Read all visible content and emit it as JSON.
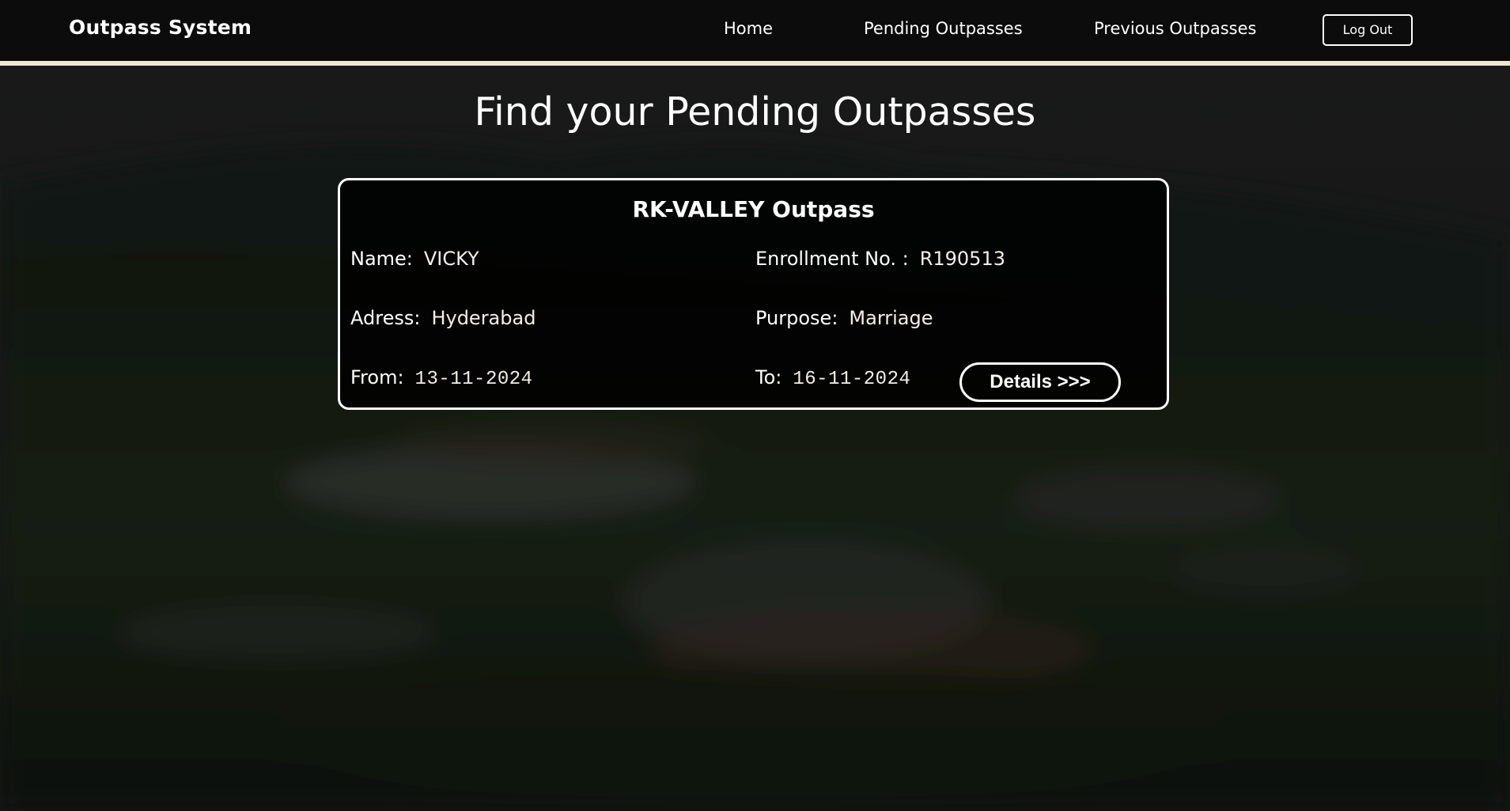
{
  "navbar": {
    "brand": "Outpass System",
    "links": {
      "home": "Home",
      "pending": "Pending Outpasses",
      "previous": "Previous Outpasses"
    },
    "logout_label": "Log Out"
  },
  "page": {
    "title": "Find your Pending Outpasses"
  },
  "outpass_card": {
    "title": "RK-VALLEY Outpass",
    "name_label": "Name:",
    "name_value": "VICKY",
    "enrollment_label": "Enrollment No. :",
    "enrollment_value": "R190513",
    "address_label": "Adress:",
    "address_value": "Hyderabad",
    "purpose_label": "Purpose:",
    "purpose_value": "Marriage",
    "from_label": "From:",
    "from_value": "13-11-2024",
    "to_label": "To:",
    "to_value": "16-11-2024",
    "details_label": "Details >>>"
  },
  "colors": {
    "navbar_bg": "#0c0c0c",
    "navbar_border": "#f1e6d3",
    "card_border": "#ffffff",
    "text": "#ffffff"
  }
}
